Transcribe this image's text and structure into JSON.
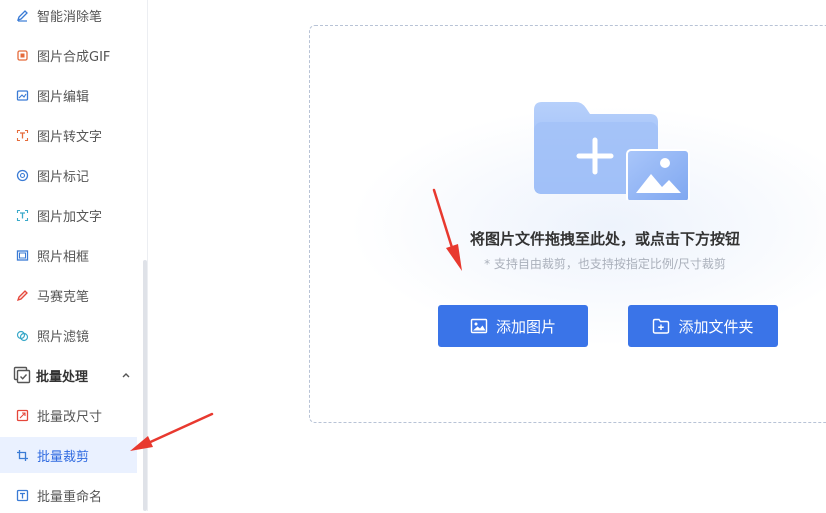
{
  "sidebar": {
    "items": [
      {
        "label": "智能消除笔",
        "icon": "pen-icon",
        "color": "#3a7bd5"
      },
      {
        "label": "图片合成GIF",
        "icon": "gif-icon",
        "color": "#e56b3b"
      },
      {
        "label": "图片编辑",
        "icon": "image-edit-icon",
        "color": "#3a7bd5"
      },
      {
        "label": "图片转文字",
        "icon": "text-extract-icon",
        "color": "#e56b3b"
      },
      {
        "label": "图片标记",
        "icon": "marker-icon",
        "color": "#3a7bd5"
      },
      {
        "label": "图片加文字",
        "icon": "add-text-icon",
        "color": "#3aa9c9"
      },
      {
        "label": "照片相框",
        "icon": "frame-icon",
        "color": "#3a7bd5"
      },
      {
        "label": "马赛克笔",
        "icon": "mosaic-pen-icon",
        "color": "#e5473b"
      },
      {
        "label": "照片滤镜",
        "icon": "filter-icon",
        "color": "#3aa9c9"
      }
    ],
    "group": {
      "label": "批量处理",
      "icon": "batch-icon"
    },
    "sub_items": [
      {
        "label": "批量改尺寸",
        "icon": "resize-icon",
        "color": "#e5473b"
      },
      {
        "label": "批量裁剪",
        "icon": "crop-icon",
        "color": "#3a7bd5",
        "active": true
      },
      {
        "label": "批量重命名",
        "icon": "rename-icon",
        "color": "#3a7bd5"
      }
    ]
  },
  "dropzone": {
    "title": "将图片文件拖拽至此处，或点击下方按钮",
    "hint": "* 支持自由裁剪，也支持按指定比例/尺寸裁剪",
    "add_images_label": "添加图片",
    "add_folder_label": "添加文件夹"
  },
  "colors": {
    "accent": "#3a74e8",
    "active_bg": "#eaf1ff",
    "annotation_arrow": "#e8392f"
  }
}
